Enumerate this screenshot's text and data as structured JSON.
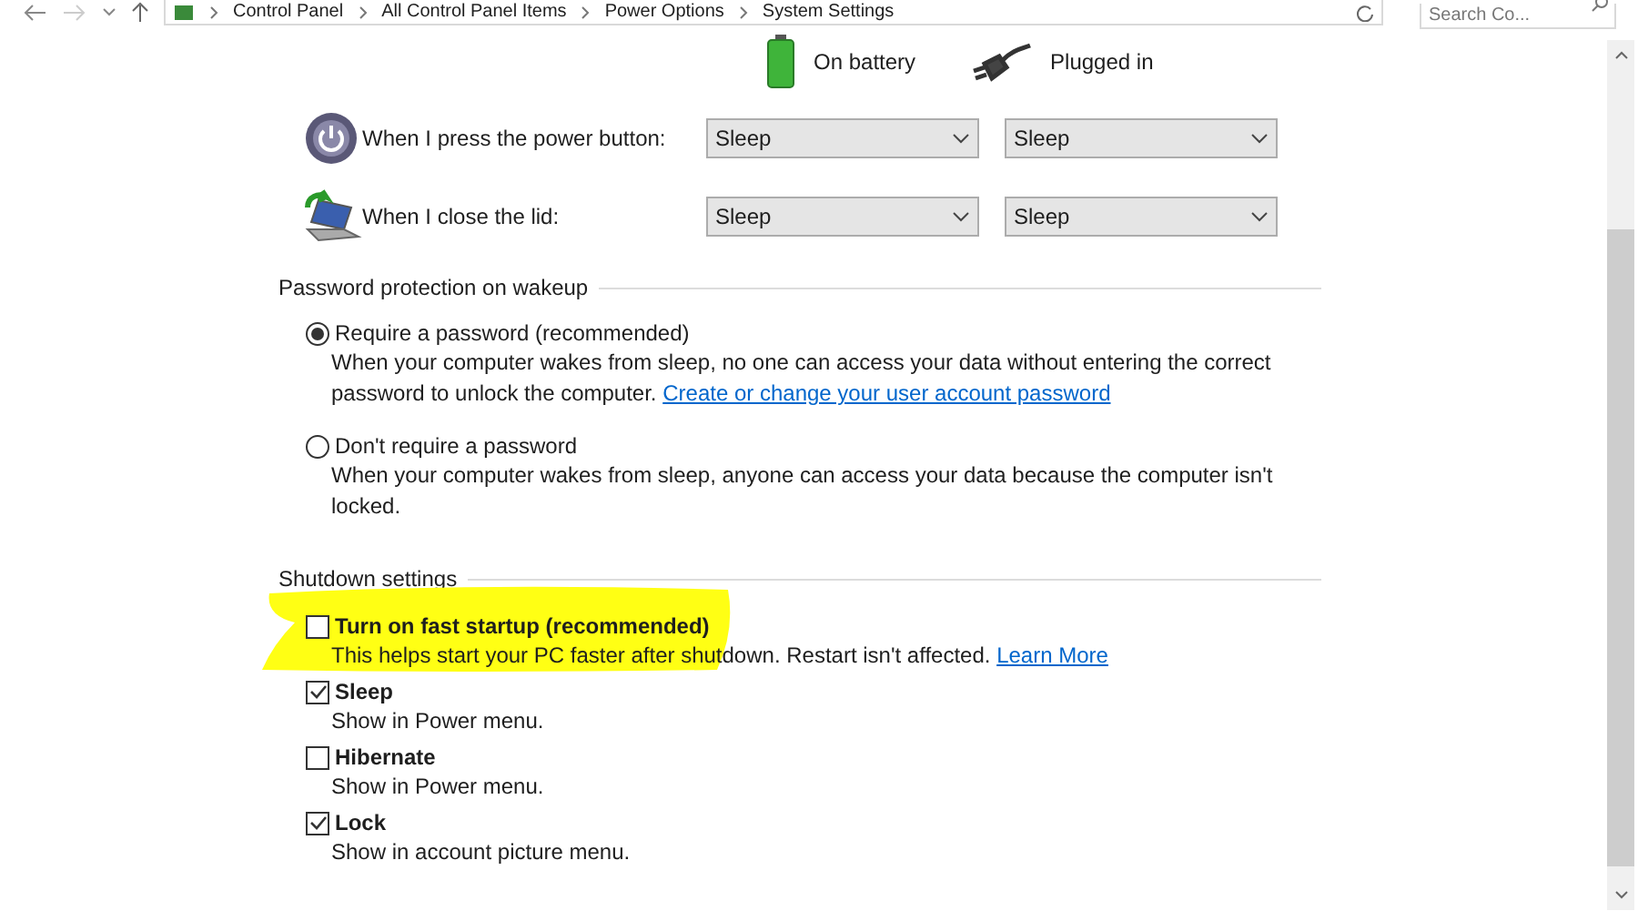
{
  "nav": {
    "breadcrumb": [
      "Control Panel",
      "All Control Panel Items",
      "Power Options",
      "System Settings"
    ],
    "search": {
      "placeholder": "Search Co..."
    }
  },
  "power_columns": [
    {
      "kind": "battery",
      "label": "On battery"
    },
    {
      "kind": "plug",
      "label": "Plugged in"
    }
  ],
  "power_rows": [
    {
      "kind": "power",
      "label": "When I press the power button:",
      "values": [
        "Sleep",
        "Sleep"
      ]
    },
    {
      "kind": "lid",
      "label": "When I close the lid:",
      "values": [
        "Sleep",
        "Sleep"
      ]
    }
  ],
  "password": {
    "title": "Password protection on wakeup",
    "options": [
      {
        "label": "Require a password (recommended)",
        "selected": true,
        "description": "When your computer wakes from sleep, no one can access your data without entering the correct password to unlock the computer.",
        "link": "Create or change your user account password"
      },
      {
        "label": "Don't require a password",
        "selected": false,
        "description": "When your computer wakes from sleep, anyone can access your data because the computer isn't locked."
      }
    ]
  },
  "shutdown": {
    "title": "Shutdown settings",
    "options": [
      {
        "label": "Turn on fast startup (recommended)",
        "checked": false,
        "highlighted": true,
        "description": "This helps start your PC faster after shutdown. Restart isn't affected.",
        "link": "Learn More"
      },
      {
        "label": "Sleep",
        "checked": true,
        "highlighted": false,
        "description": "Show in Power menu."
      },
      {
        "label": "Hibernate",
        "checked": false,
        "highlighted": false,
        "description": "Show in Power menu."
      },
      {
        "label": "Lock",
        "checked": true,
        "highlighted": false,
        "description": "Show in account picture menu."
      }
    ]
  }
}
